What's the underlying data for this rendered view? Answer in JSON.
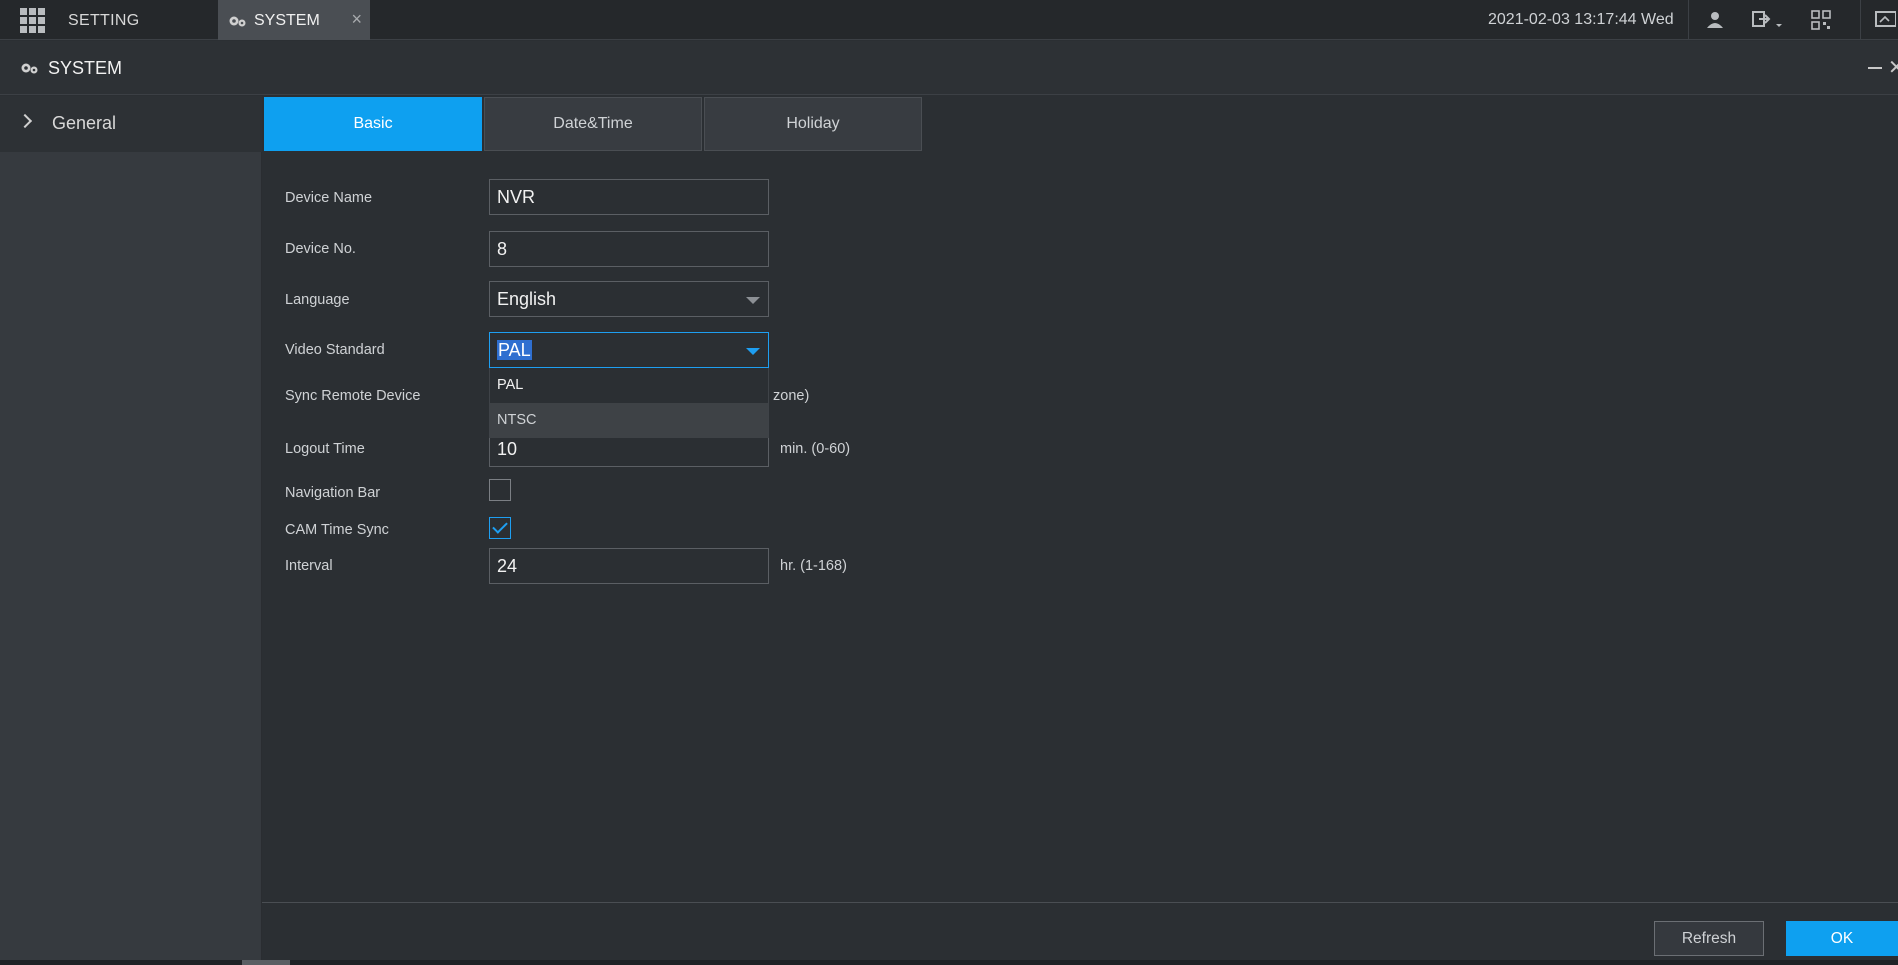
{
  "topbar": {
    "menu_label": "SETTING",
    "active_tab_label": "SYSTEM",
    "tab_close": "×",
    "datetime": "2021-02-03 13:17:44 Wed"
  },
  "window": {
    "title": "SYSTEM",
    "close": "✕"
  },
  "sidebar": {
    "items": [
      {
        "label": "General"
      }
    ]
  },
  "tabs": [
    {
      "label": "Basic",
      "active": true
    },
    {
      "label": "Date&Time",
      "active": false
    },
    {
      "label": "Holiday",
      "active": false
    }
  ],
  "form": {
    "device_name": {
      "label": "Device Name",
      "value": "NVR"
    },
    "device_no": {
      "label": "Device No.",
      "value": "8"
    },
    "language": {
      "label": "Language",
      "value": "English"
    },
    "video_standard": {
      "label": "Video Standard",
      "value": "PAL",
      "options": [
        "PAL",
        "NTSC"
      ]
    },
    "sync_remote_device": {
      "label": "Sync Remote Device",
      "hint_suffix": "zone)"
    },
    "logout_time": {
      "label": "Logout Time",
      "value": "10",
      "hint": "min. (0-60)"
    },
    "navigation_bar": {
      "label": "Navigation Bar",
      "checked": false
    },
    "cam_time_sync": {
      "label": "CAM Time Sync",
      "checked": true
    },
    "interval": {
      "label": "Interval",
      "value": "24",
      "hint": "hr. (1-168)"
    }
  },
  "buttons": {
    "refresh": "Refresh",
    "ok": "OK"
  },
  "colors": {
    "accent": "#0ea0f0",
    "background": "#2b2f33"
  }
}
